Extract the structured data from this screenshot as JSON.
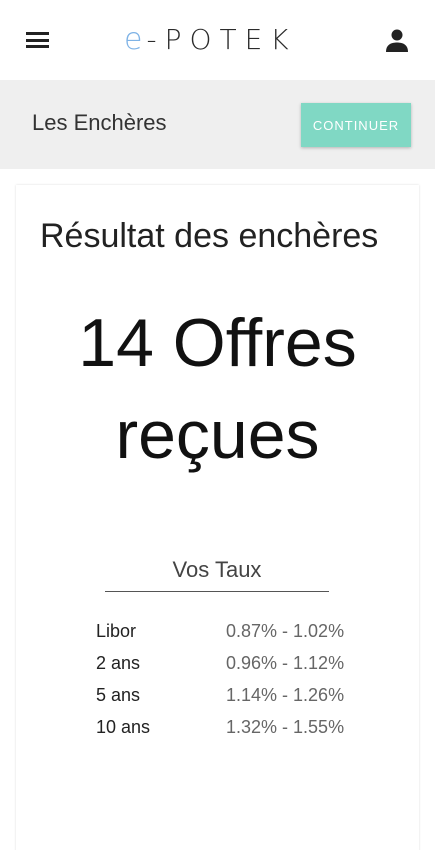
{
  "header": {
    "logo_accent": "e",
    "logo_rest": "-POTEK",
    "menu_icon": "menu-icon",
    "user_icon": "person-icon"
  },
  "subbar": {
    "title": "Les Enchères",
    "continue_label": "CONTINUER"
  },
  "card": {
    "title": "Résultat des enchères",
    "offers_line1": "14 Offres",
    "offers_line2": "reçues",
    "rates_heading": "Vos Taux",
    "rates": [
      {
        "label": "Libor",
        "value": "0.87% - 1.02%"
      },
      {
        "label": "2 ans",
        "value": "0.96% - 1.12%"
      },
      {
        "label": "5 ans",
        "value": "1.14% - 1.26%"
      },
      {
        "label": "10 ans",
        "value": "1.32% - 1.55%"
      }
    ]
  },
  "colors": {
    "accent_button": "#80d8c4",
    "logo_accent": "#7fb3e6",
    "subbar_bg": "#efefef"
  }
}
